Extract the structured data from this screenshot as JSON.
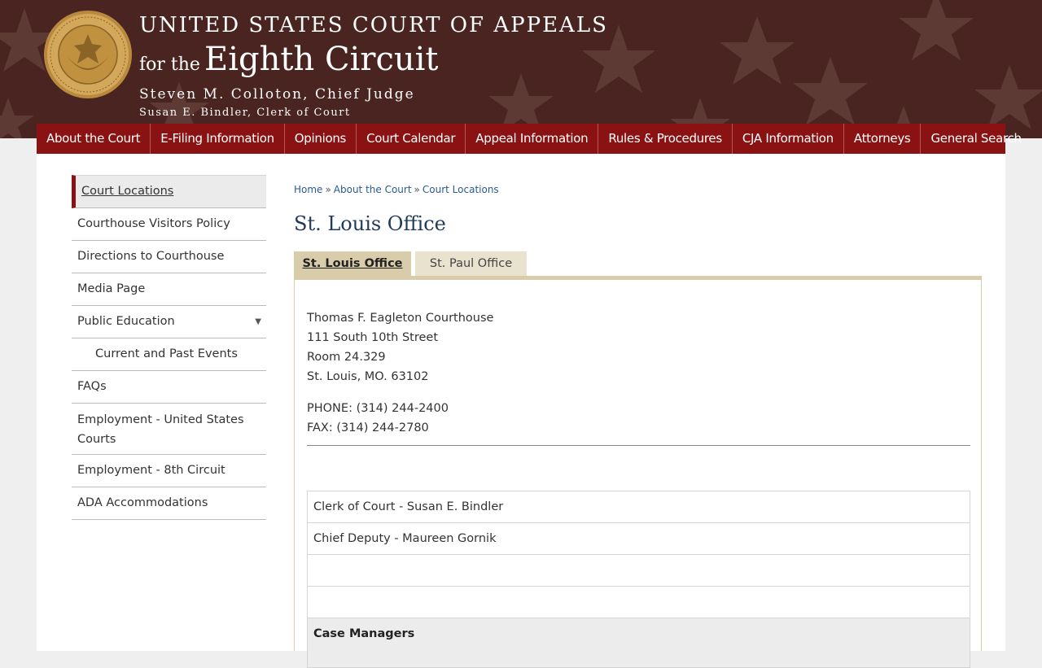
{
  "header": {
    "title_line1": "UNITED STATES COURT OF APPEALS",
    "title_prefix": "for the",
    "title_main": "Eighth Circuit",
    "chief_judge": "Steven M. Colloton, Chief Judge",
    "clerk": "Susan E. Bindler, Clerk of Court",
    "seal_text": "UNITED STATES COURT OF APPEALS FOR THE EIGHTH CIRCUIT"
  },
  "colors": {
    "header_bg": "#4a2420",
    "nav_bg": "#8b1212",
    "accent_gold": "#d8ccaa",
    "link": "#2a5b8e"
  },
  "nav": {
    "items": [
      {
        "label": "About the Court"
      },
      {
        "label": "E-Filing Information"
      },
      {
        "label": "Opinions"
      },
      {
        "label": "Court Calendar"
      },
      {
        "label": "Appeal Information"
      },
      {
        "label": "Rules & Procedures"
      },
      {
        "label": "CJA Information"
      },
      {
        "label": "Attorneys"
      },
      {
        "label": "General Search"
      }
    ]
  },
  "sidebar": {
    "items": [
      {
        "label": "Court Locations"
      },
      {
        "label": "Courthouse Visitors Policy"
      },
      {
        "label": "Directions to Courthouse"
      },
      {
        "label": "Media Page"
      },
      {
        "label": "Public Education",
        "caret": "▼"
      },
      {
        "label": "Current and Past Events"
      },
      {
        "label": "FAQs"
      },
      {
        "label": "Employment - United States Courts"
      },
      {
        "label": "Employment - 8th Circuit"
      },
      {
        "label": "ADA Accommodations"
      }
    ]
  },
  "breadcrumb": {
    "items": [
      "Home",
      "About the Court",
      "Court Locations"
    ],
    "separator": "»"
  },
  "page": {
    "title": "St. Louis Office"
  },
  "tabs": [
    {
      "label": "St. Louis Office"
    },
    {
      "label": "St. Paul Office"
    }
  ],
  "office": {
    "address": [
      "Thomas F. Eagleton Courthouse",
      "111 South 10th Street",
      "Room 24.329",
      "St. Louis, MO. 63102"
    ],
    "phone": "PHONE: (314) 244-2400",
    "fax": "FAX: (314) 244-2780"
  },
  "staff": {
    "rows": [
      {
        "text": "Clerk of Court  -   Susan E. Bindler"
      },
      {
        "text": "Chief Deputy  -   Maureen Gornik"
      },
      {
        "text": ""
      },
      {
        "text": ""
      }
    ],
    "section_heading": "Case Managers"
  }
}
